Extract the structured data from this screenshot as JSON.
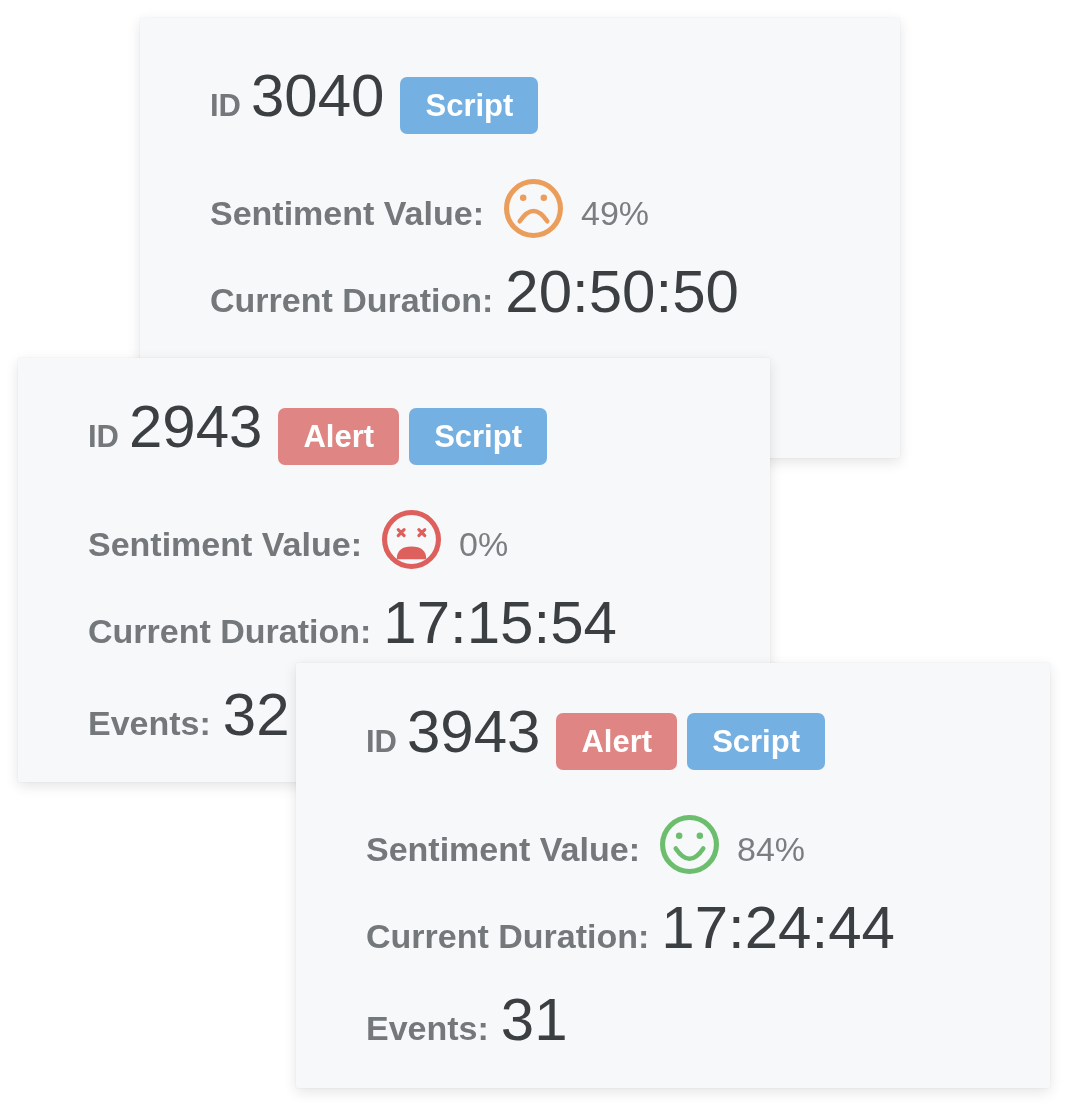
{
  "cards": [
    {
      "id_label": "ID",
      "id": "3040",
      "tags": [
        {
          "text": "Script",
          "color": "#75b0e3"
        }
      ],
      "sentiment": {
        "label": "Sentiment Value:",
        "kind": "sad",
        "color": "#eb9d5c",
        "value": "49%"
      },
      "duration": {
        "label": "Current Duration:",
        "value": "20:50:50"
      }
    },
    {
      "id_label": "ID",
      "id": "2943",
      "tags": [
        {
          "text": "Alert",
          "color": "#df8583"
        },
        {
          "text": "Script",
          "color": "#75b0e3"
        }
      ],
      "sentiment": {
        "label": "Sentiment Value:",
        "kind": "dizzy",
        "color": "#de605c",
        "value": "0%"
      },
      "duration": {
        "label": "Current Duration:",
        "value": "17:15:54"
      },
      "events": {
        "label": "Events:",
        "value": "32"
      }
    },
    {
      "id_label": "ID",
      "id": "3943",
      "tags": [
        {
          "text": "Alert",
          "color": "#df8583"
        },
        {
          "text": "Script",
          "color": "#75b0e3"
        }
      ],
      "sentiment": {
        "label": "Sentiment Value:",
        "kind": "happy",
        "color": "#6cbd6e",
        "value": "84%"
      },
      "duration": {
        "label": "Current Duration:",
        "value": "17:24:44"
      },
      "events": {
        "label": "Events:",
        "value": "31"
      }
    }
  ]
}
